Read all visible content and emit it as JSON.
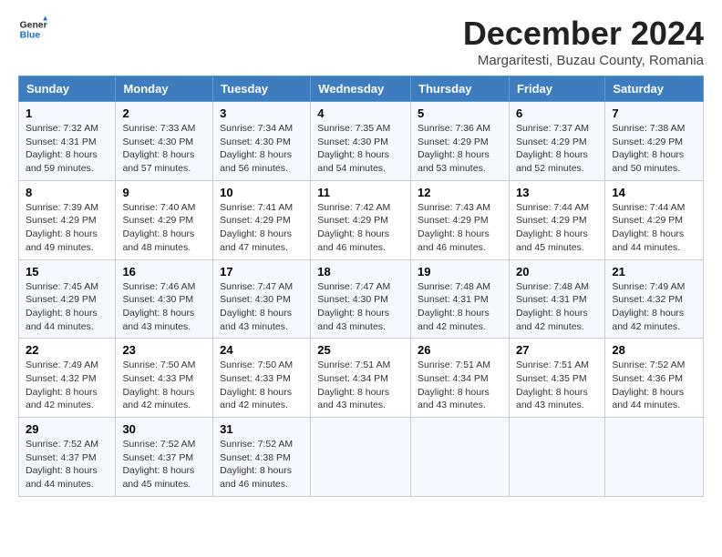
{
  "logo": {
    "line1": "General",
    "line2": "Blue"
  },
  "title": "December 2024",
  "subtitle": "Margaritesti, Buzau County, Romania",
  "weekdays": [
    "Sunday",
    "Monday",
    "Tuesday",
    "Wednesday",
    "Thursday",
    "Friday",
    "Saturday"
  ],
  "weeks": [
    [
      {
        "day": "1",
        "sunrise": "7:32 AM",
        "sunset": "4:31 PM",
        "daylight": "8 hours and 59 minutes."
      },
      {
        "day": "2",
        "sunrise": "7:33 AM",
        "sunset": "4:30 PM",
        "daylight": "8 hours and 57 minutes."
      },
      {
        "day": "3",
        "sunrise": "7:34 AM",
        "sunset": "4:30 PM",
        "daylight": "8 hours and 56 minutes."
      },
      {
        "day": "4",
        "sunrise": "7:35 AM",
        "sunset": "4:30 PM",
        "daylight": "8 hours and 54 minutes."
      },
      {
        "day": "5",
        "sunrise": "7:36 AM",
        "sunset": "4:29 PM",
        "daylight": "8 hours and 53 minutes."
      },
      {
        "day": "6",
        "sunrise": "7:37 AM",
        "sunset": "4:29 PM",
        "daylight": "8 hours and 52 minutes."
      },
      {
        "day": "7",
        "sunrise": "7:38 AM",
        "sunset": "4:29 PM",
        "daylight": "8 hours and 50 minutes."
      }
    ],
    [
      {
        "day": "8",
        "sunrise": "7:39 AM",
        "sunset": "4:29 PM",
        "daylight": "8 hours and 49 minutes."
      },
      {
        "day": "9",
        "sunrise": "7:40 AM",
        "sunset": "4:29 PM",
        "daylight": "8 hours and 48 minutes."
      },
      {
        "day": "10",
        "sunrise": "7:41 AM",
        "sunset": "4:29 PM",
        "daylight": "8 hours and 47 minutes."
      },
      {
        "day": "11",
        "sunrise": "7:42 AM",
        "sunset": "4:29 PM",
        "daylight": "8 hours and 46 minutes."
      },
      {
        "day": "12",
        "sunrise": "7:43 AM",
        "sunset": "4:29 PM",
        "daylight": "8 hours and 46 minutes."
      },
      {
        "day": "13",
        "sunrise": "7:44 AM",
        "sunset": "4:29 PM",
        "daylight": "8 hours and 45 minutes."
      },
      {
        "day": "14",
        "sunrise": "7:44 AM",
        "sunset": "4:29 PM",
        "daylight": "8 hours and 44 minutes."
      }
    ],
    [
      {
        "day": "15",
        "sunrise": "7:45 AM",
        "sunset": "4:29 PM",
        "daylight": "8 hours and 44 minutes."
      },
      {
        "day": "16",
        "sunrise": "7:46 AM",
        "sunset": "4:30 PM",
        "daylight": "8 hours and 43 minutes."
      },
      {
        "day": "17",
        "sunrise": "7:47 AM",
        "sunset": "4:30 PM",
        "daylight": "8 hours and 43 minutes."
      },
      {
        "day": "18",
        "sunrise": "7:47 AM",
        "sunset": "4:30 PM",
        "daylight": "8 hours and 43 minutes."
      },
      {
        "day": "19",
        "sunrise": "7:48 AM",
        "sunset": "4:31 PM",
        "daylight": "8 hours and 42 minutes."
      },
      {
        "day": "20",
        "sunrise": "7:48 AM",
        "sunset": "4:31 PM",
        "daylight": "8 hours and 42 minutes."
      },
      {
        "day": "21",
        "sunrise": "7:49 AM",
        "sunset": "4:32 PM",
        "daylight": "8 hours and 42 minutes."
      }
    ],
    [
      {
        "day": "22",
        "sunrise": "7:49 AM",
        "sunset": "4:32 PM",
        "daylight": "8 hours and 42 minutes."
      },
      {
        "day": "23",
        "sunrise": "7:50 AM",
        "sunset": "4:33 PM",
        "daylight": "8 hours and 42 minutes."
      },
      {
        "day": "24",
        "sunrise": "7:50 AM",
        "sunset": "4:33 PM",
        "daylight": "8 hours and 42 minutes."
      },
      {
        "day": "25",
        "sunrise": "7:51 AM",
        "sunset": "4:34 PM",
        "daylight": "8 hours and 43 minutes."
      },
      {
        "day": "26",
        "sunrise": "7:51 AM",
        "sunset": "4:34 PM",
        "daylight": "8 hours and 43 minutes."
      },
      {
        "day": "27",
        "sunrise": "7:51 AM",
        "sunset": "4:35 PM",
        "daylight": "8 hours and 43 minutes."
      },
      {
        "day": "28",
        "sunrise": "7:52 AM",
        "sunset": "4:36 PM",
        "daylight": "8 hours and 44 minutes."
      }
    ],
    [
      {
        "day": "29",
        "sunrise": "7:52 AM",
        "sunset": "4:37 PM",
        "daylight": "8 hours and 44 minutes."
      },
      {
        "day": "30",
        "sunrise": "7:52 AM",
        "sunset": "4:37 PM",
        "daylight": "8 hours and 45 minutes."
      },
      {
        "day": "31",
        "sunrise": "7:52 AM",
        "sunset": "4:38 PM",
        "daylight": "8 hours and 46 minutes."
      },
      null,
      null,
      null,
      null
    ]
  ],
  "labels": {
    "sunrise": "Sunrise:",
    "sunset": "Sunset:",
    "daylight": "Daylight:"
  }
}
